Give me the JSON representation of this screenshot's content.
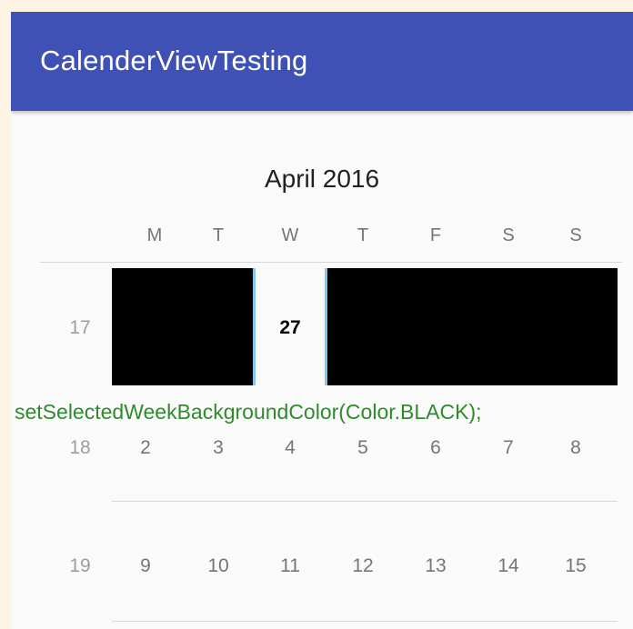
{
  "app_bar": {
    "title": "CalenderViewTesting",
    "color": "#3f51b5"
  },
  "calendar": {
    "month_title": "April 2016",
    "weekday_headers": [
      "M",
      "T",
      "W",
      "T",
      "F",
      "S",
      "S"
    ],
    "weeks": [
      {
        "week_number": "17",
        "days": [
          "",
          "",
          "27",
          "",
          "",
          "",
          ""
        ],
        "selected": true,
        "selected_background": "#000000",
        "focused_day": "27"
      },
      {
        "week_number": "18",
        "days": [
          "2",
          "3",
          "4",
          "5",
          "6",
          "7",
          "8"
        ]
      },
      {
        "week_number": "19",
        "days": [
          "9",
          "10",
          "11",
          "12",
          "13",
          "14",
          "15"
        ]
      }
    ]
  },
  "annotation": {
    "text": "setSelectedWeekBackgroundColor(Color.BLACK);",
    "color": "#2e8b2e"
  }
}
